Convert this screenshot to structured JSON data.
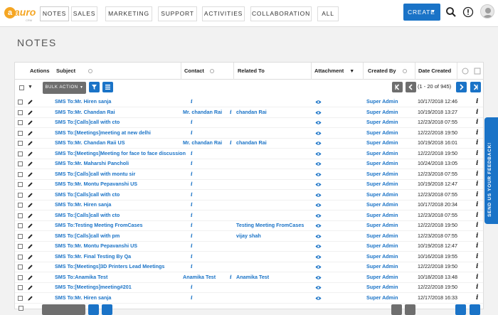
{
  "brand": {
    "name": "auro",
    "letter": "a",
    "sub": "CRM"
  },
  "nav": {
    "tabs": [
      "NOTES",
      "SALES",
      "MARKETING",
      "SUPPORT",
      "ACTIVITIES",
      "COLLABORATION",
      "ALL"
    ],
    "create_label": "CREATE"
  },
  "page": {
    "title": "NOTES"
  },
  "table": {
    "headers": {
      "actions": "Actions",
      "subject": "Subject",
      "contact": "Contact",
      "related_to": "Related To",
      "attachment": "Attachment",
      "created_by": "Created By",
      "date_created": "Date Created"
    },
    "bulk_action_label": "BULK ACTION",
    "pagination": "(1 - 20 of 945)",
    "rows": [
      {
        "subject": "SMS To:Mr. Hiren sanja",
        "contact": "",
        "related": "",
        "created_by": "Super Admin",
        "date": "10/17/2018 12:46"
      },
      {
        "subject": "SMS To:Mr. Chandan Rai",
        "contact": "Mr. chandan Rai",
        "related": "chandan Rai",
        "created_by": "Super Admin",
        "date": "10/19/2018 13:27"
      },
      {
        "subject": "SMS To:[Calls]call with cto",
        "contact": "",
        "related": "",
        "created_by": "Super Admin",
        "date": "12/23/2018 07:55"
      },
      {
        "subject": "SMS To:[Meetings]meeting at new delhi",
        "contact": "",
        "related": "",
        "created_by": "Super Admin",
        "date": "12/22/2018 19:50"
      },
      {
        "subject": "SMS To:Mr. Chandan Raii US",
        "contact": "Mr. chandan Rai",
        "related": "chandan Rai",
        "created_by": "Super Admin",
        "date": "10/19/2018 16:01"
      },
      {
        "subject": "SMS To:[Meetings]Meeting for face to face discussion",
        "contact": "",
        "related": "",
        "created_by": "Super Admin",
        "date": "12/22/2018 19:50"
      },
      {
        "subject": "SMS To:Mr. Maharshi Pancholi",
        "contact": "",
        "related": "",
        "created_by": "Super Admin",
        "date": "10/24/2018 13:05"
      },
      {
        "subject": "SMS To:[Calls]call with montu sir",
        "contact": "",
        "related": "",
        "created_by": "Super Admin",
        "date": "12/23/2018 07:55"
      },
      {
        "subject": "SMS To:Mr. Montu Pepavanshi US",
        "contact": "",
        "related": "",
        "created_by": "Super Admin",
        "date": "10/19/2018 12:47"
      },
      {
        "subject": "SMS To:[Calls]call with cto",
        "contact": "",
        "related": "",
        "created_by": "Super Admin",
        "date": "12/23/2018 07:55"
      },
      {
        "subject": "SMS To:Mr. Hiren sanja",
        "contact": "",
        "related": "",
        "created_by": "Super Admin",
        "date": "10/17/2018 20:34"
      },
      {
        "subject": "SMS To:[Calls]call with cto",
        "contact": "",
        "related": "",
        "created_by": "Super Admin",
        "date": "12/23/2018 07:55"
      },
      {
        "subject": "SMS To:Testing Meeting FromCases",
        "contact": "",
        "related": "Testing Meeting FromCases",
        "created_by": "Super Admin",
        "date": "12/22/2018 19:50"
      },
      {
        "subject": "SMS To:[Calls]call with pm",
        "contact": "",
        "related": "vijay shah",
        "created_by": "Super Admin",
        "date": "12/23/2018 07:55"
      },
      {
        "subject": "SMS To:Mr. Montu Pepavanshi US",
        "contact": "",
        "related": "",
        "created_by": "Super Admin",
        "date": "10/19/2018 12:47"
      },
      {
        "subject": "SMS To:Mr. Final Testing By Qa",
        "contact": "",
        "related": "",
        "created_by": "Super Admin",
        "date": "10/16/2018 19:55"
      },
      {
        "subject": "SMS To:[Meetings]3D Printers Lead Meetings",
        "contact": "",
        "related": "",
        "created_by": "Super Admin",
        "date": "12/22/2018 19:50"
      },
      {
        "subject": "SMS To:Anamika Test",
        "contact": "Anamika Test",
        "related": "Anamika Test",
        "created_by": "Super Admin",
        "date": "10/18/2018 13:48"
      },
      {
        "subject": "SMS To:[Meetings]meeting#201",
        "contact": "",
        "related": "",
        "created_by": "Super Admin",
        "date": "12/22/2018 19:50"
      },
      {
        "subject": "SMS To:Mr. Hiren sanja",
        "contact": "",
        "related": "",
        "created_by": "Super Admin",
        "date": "12/17/2018 16:33"
      }
    ]
  },
  "feedback": {
    "label": "SEND US YOUR FEEDBACK!"
  },
  "colors": {
    "primary": "#1a73c7",
    "brand": "#f5a623",
    "grey_button": "#6e6e6e"
  },
  "icons": [
    "search-icon",
    "notification-icon",
    "avatar-icon",
    "edit-icon",
    "info-icon",
    "eye-icon",
    "filter-icon",
    "list-icon"
  ]
}
